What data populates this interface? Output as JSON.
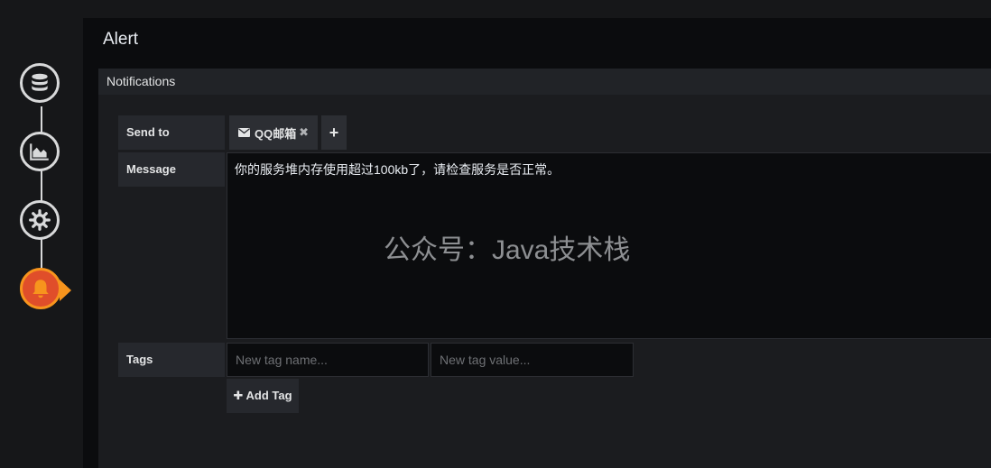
{
  "wizard": {
    "steps": [
      {
        "name": "queries",
        "icon": "database-icon"
      },
      {
        "name": "visualization",
        "icon": "area-chart-icon"
      },
      {
        "name": "general",
        "icon": "cog-icon"
      },
      {
        "name": "alert",
        "icon": "bell-icon",
        "active": true
      }
    ],
    "active_color": "#f7941d"
  },
  "panel": {
    "title": "Alert",
    "section_title": "Notifications"
  },
  "send_to": {
    "label": "Send to",
    "chip_label": "QQ邮箱",
    "chip_icon": "envelope-icon",
    "remove_icon": "close-icon",
    "add_icon": "plus-icon"
  },
  "message": {
    "label": "Message",
    "value": "你的服务堆内存使用超过100kb了，请检查服务是否正常。"
  },
  "watermark": "公众号：Java技术栈",
  "tags": {
    "label": "Tags",
    "name_placeholder": "New tag name...",
    "value_placeholder": "New tag value...",
    "add_label": "Add Tag",
    "add_icon": "plus-icon"
  }
}
